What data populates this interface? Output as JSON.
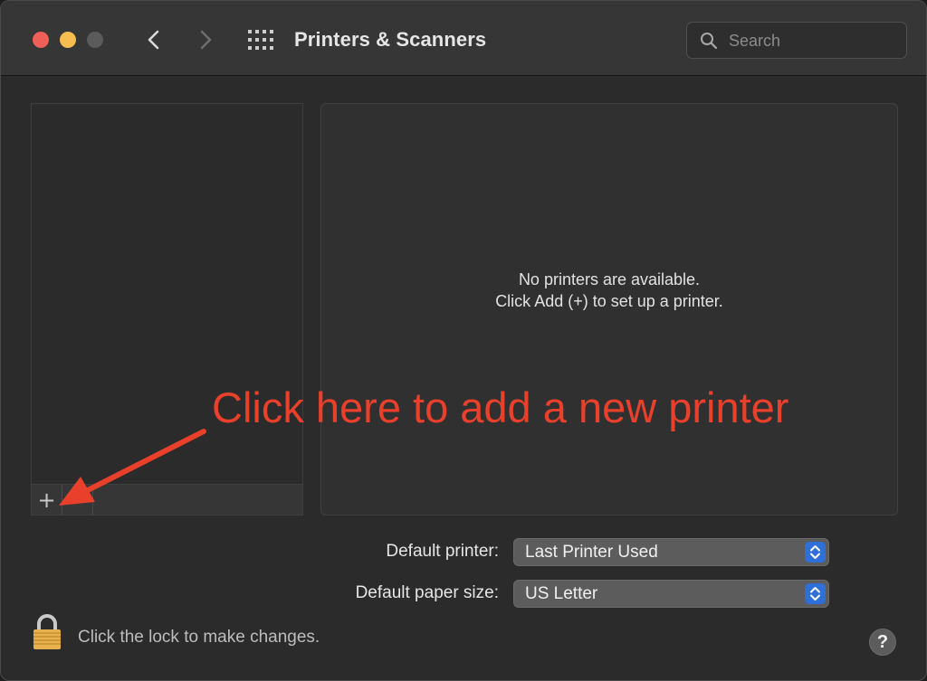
{
  "window": {
    "title": "Printers & Scanners",
    "search": {
      "placeholder": "Search",
      "value": ""
    }
  },
  "printer_list": {
    "items": [],
    "add_button": "+",
    "remove_button": "−"
  },
  "detail": {
    "empty_line1": "No printers are available.",
    "empty_line2": "Click Add (+) to set up a printer."
  },
  "annotation": {
    "text": "Click here to add a new printer",
    "color": "#e8402b"
  },
  "settings": {
    "default_printer_label": "Default printer:",
    "default_printer_value": "Last Printer Used",
    "default_paper_label": "Default paper size:",
    "default_paper_value": "US Letter"
  },
  "footer": {
    "lock_text": "Click the lock to make changes.",
    "help_label": "?"
  },
  "colors": {
    "close": "#ee5f57",
    "minimize": "#f6be4f",
    "zoom_disabled": "#5b5b5b",
    "accent": "#2f6fd8"
  }
}
